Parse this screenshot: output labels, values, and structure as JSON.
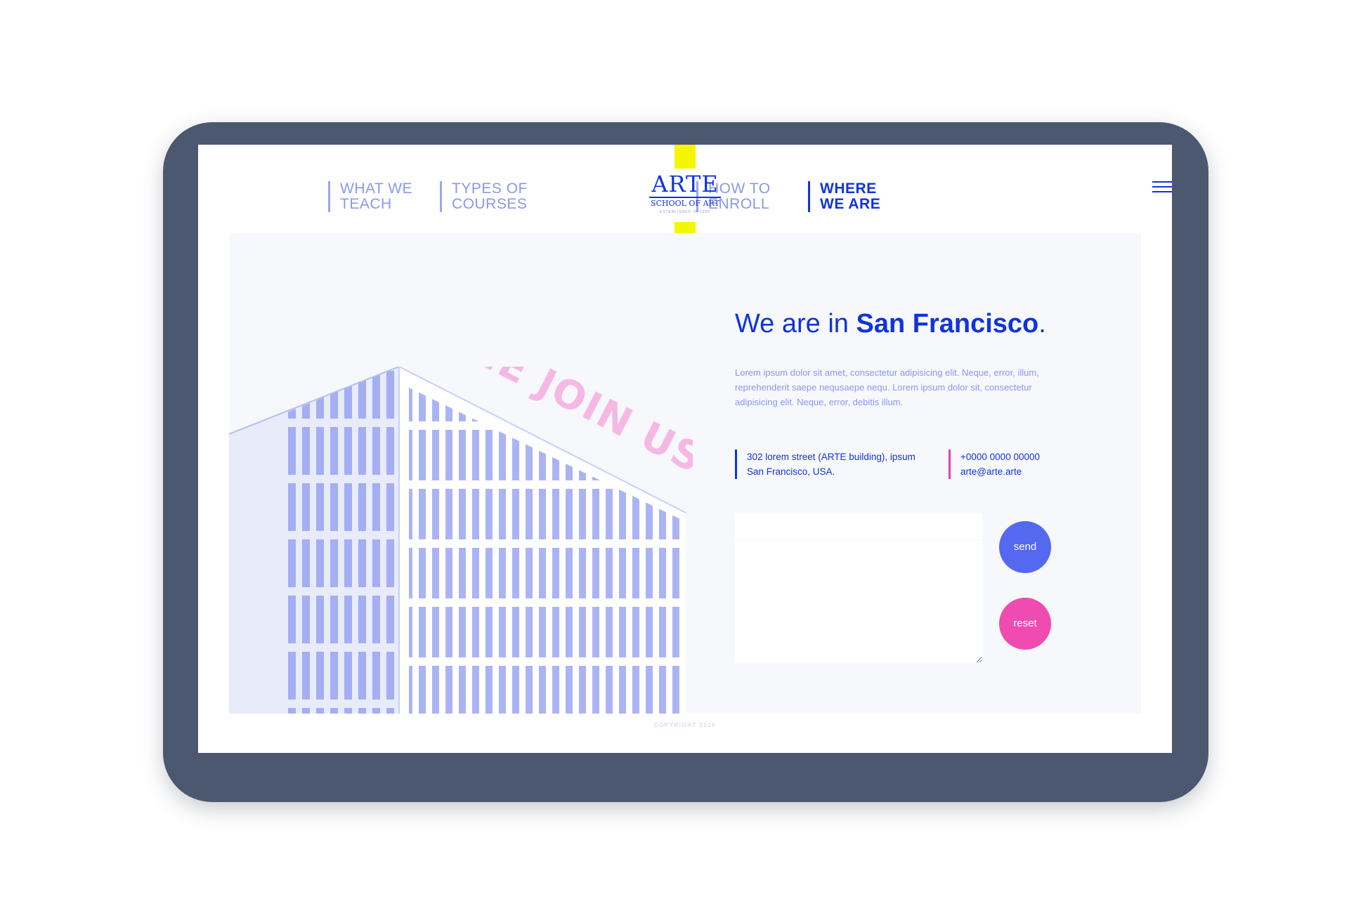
{
  "nav": {
    "what_we_teach": "WHAT WE\nTEACH",
    "types_of_courses": "TYPES OF\nCOURSES",
    "how_to_enroll": "HOW TO\nENROLL",
    "where_we_are": "WHERE\nWE ARE"
  },
  "logo": {
    "title": "ARTE",
    "subtitle": "SCHOOL OF ART",
    "established": "ESTABLISHED IN 1986"
  },
  "menu_icon": "hamburger-menu-icon",
  "illustration": {
    "banner_text": "COME JOIN US!"
  },
  "location": {
    "heading_prefix": "We are in ",
    "heading_city": "San Francisco",
    "heading_suffix": ".",
    "description": "Lorem ipsum dolor sit amet, consectetur adipisicing elit. Neque, error, illum, reprehenderit saepe nequsaepe nequ. Lorem ipsum dolor sit, consectetur adipisicing elit. Neque, error, debitis illum.",
    "address_line1": "302 lorem street (ARTE building), ipsum",
    "address_line2": "San Francisco, USA.",
    "phone": "+0000 0000 00000",
    "email": "arte@arte.arte"
  },
  "form": {
    "send_label": "send",
    "reset_label": "reset"
  },
  "footer": {
    "copyright": "COPYRIGHT 2016"
  },
  "colors": {
    "primary": "#1133dd",
    "accent_yellow": "#f4f600",
    "accent_pink": "#f04bb0",
    "send_blue": "#5468f0",
    "frame": "#4b5870"
  }
}
